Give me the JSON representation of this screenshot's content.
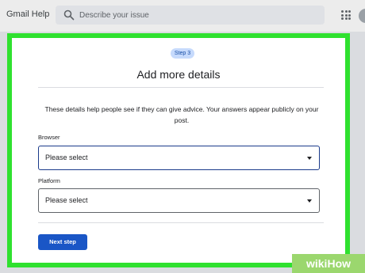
{
  "header": {
    "app_title": "Gmail Help",
    "search_placeholder": "Describe your issue",
    "icons": [
      "search-icon",
      "apps-grid-icon",
      "avatar"
    ]
  },
  "form": {
    "step_badge": "Step 3",
    "title": "Add more details",
    "description": "These details help people see if they can give advice. Your answers appear publicly on your post.",
    "browser": {
      "label": "Browser",
      "value": "Please select"
    },
    "platform": {
      "label": "Platform",
      "value": "Please select"
    },
    "next_button": "Next step"
  },
  "watermark": {
    "part1": "wiki",
    "part2": "How"
  },
  "colors": {
    "highlight_frame": "#2fe12f",
    "primary_button": "#1a56c6",
    "badge_bg": "#c6dafc"
  }
}
